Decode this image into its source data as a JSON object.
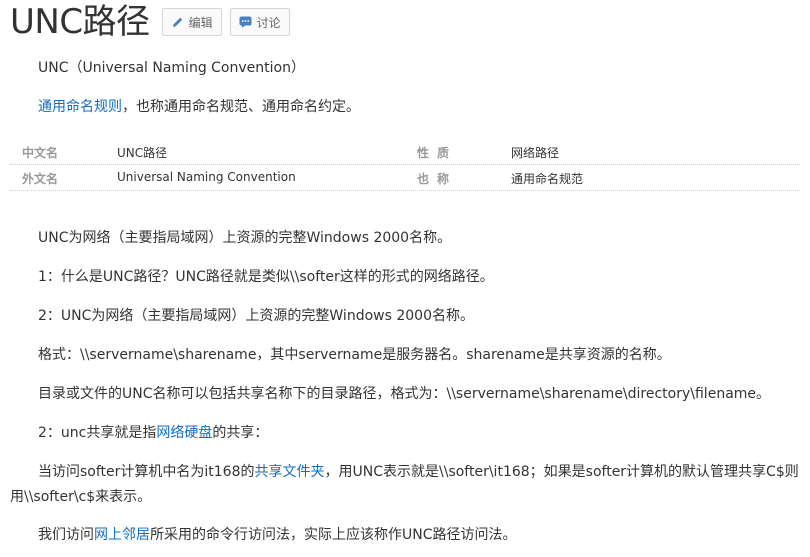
{
  "header": {
    "title": "UNC路径",
    "edit_label": "编辑",
    "discuss_label": "讨论"
  },
  "intro": {
    "line1": "UNC（Universal Naming Convention）",
    "line2_link": "通用命名规则",
    "line2_rest": "，也称通用命名规范、通用命名约定。"
  },
  "infobox": {
    "rows": [
      {
        "k1": "中文名",
        "v1": "UNC路径",
        "k2": "性质",
        "v2": "网络路径"
      },
      {
        "k1": "外文名",
        "v1": "Universal Naming Convention",
        "k2": "也称",
        "v2": "通用命名规范"
      }
    ]
  },
  "body": {
    "p1": "UNC为网络（主要指局域网）上资源的完整Windows 2000名称。",
    "p2": "1：什么是UNC路径？UNC路径就是类似\\\\softer这样的形式的网络路径。",
    "p3": "2：UNC为网络（主要指局域网）上资源的完整Windows 2000名称。",
    "p4": "格式：\\\\servername\\sharename，其中servername是服务器名。sharename是共享资源的名称。",
    "p5": "目录或文件的UNC名称可以包括共享名称下的目录路径，格式为：\\\\servername\\sharename\\directory\\filename。",
    "p6_pre": "2：unc共享就是指",
    "p6_link": "网络硬盘",
    "p6_post": "的共享：",
    "p7_pre": "当访问softer计算机中名为it168的",
    "p7_link": "共享文件夹",
    "p7_post": "，用UNC表示就是\\\\softer\\it168；如果是softer计算机的默认管理共享C$则用\\\\softer\\c$来表示。",
    "p8_pre": "我们访问",
    "p8_link": "网上邻居",
    "p8_post": "所采用的命令行访问法，实际上应该称作UNC路径访问法。"
  },
  "colors": {
    "link": "#136ec2",
    "text": "#333333",
    "label": "#999999"
  }
}
